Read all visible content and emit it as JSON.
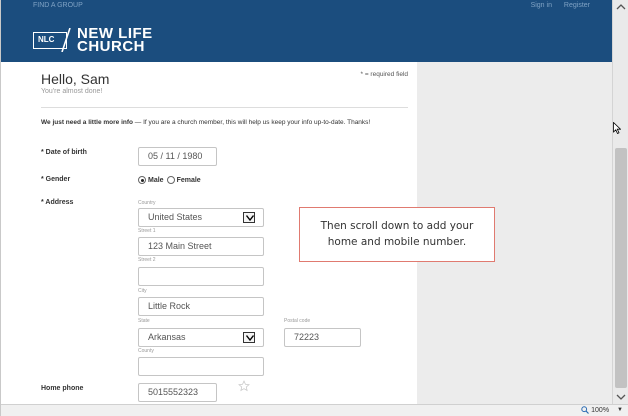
{
  "topnav": {
    "left": "FIND A GROUP",
    "sign_in": "Sign in",
    "register": "Register"
  },
  "logo": {
    "badge": "NLC",
    "line1": "NEW LIFE",
    "line2": "CHURCH"
  },
  "form": {
    "greeting": "Hello, Sam",
    "subtitle": "You're almost done!",
    "required_note": "* = required field",
    "intro_bold": "We just need a little more info",
    "intro_rest": " — If you are a church member, this will help us keep your info up-to-date. Thanks!",
    "dob": {
      "label": "Date of birth",
      "value": "05 / 11 / 1980"
    },
    "gender": {
      "label": "Gender",
      "male": "Male",
      "female": "Female",
      "selected": "Male"
    },
    "address": {
      "label": "Address",
      "country_label": "Country",
      "country_value": "United States",
      "street1_label": "Street 1",
      "street1_value": "123 Main Street",
      "street2_label": "Street 2",
      "street2_value": "",
      "city_label": "City",
      "city_value": "Little Rock",
      "state_label": "State",
      "state_value": "Arkansas",
      "postal_label": "Postal code",
      "postal_value": "72223",
      "county_label": "County",
      "county_value": ""
    },
    "home_phone": {
      "label": "Home phone",
      "value": "5015552323"
    }
  },
  "callout": {
    "line1": "Then scroll down to add your",
    "line2": "home and mobile number."
  },
  "statusbar": {
    "zoom": "100%"
  },
  "colors": {
    "header": "#1b4d7e",
    "callout_border": "#e07a70",
    "sidebar": "#ececec"
  }
}
